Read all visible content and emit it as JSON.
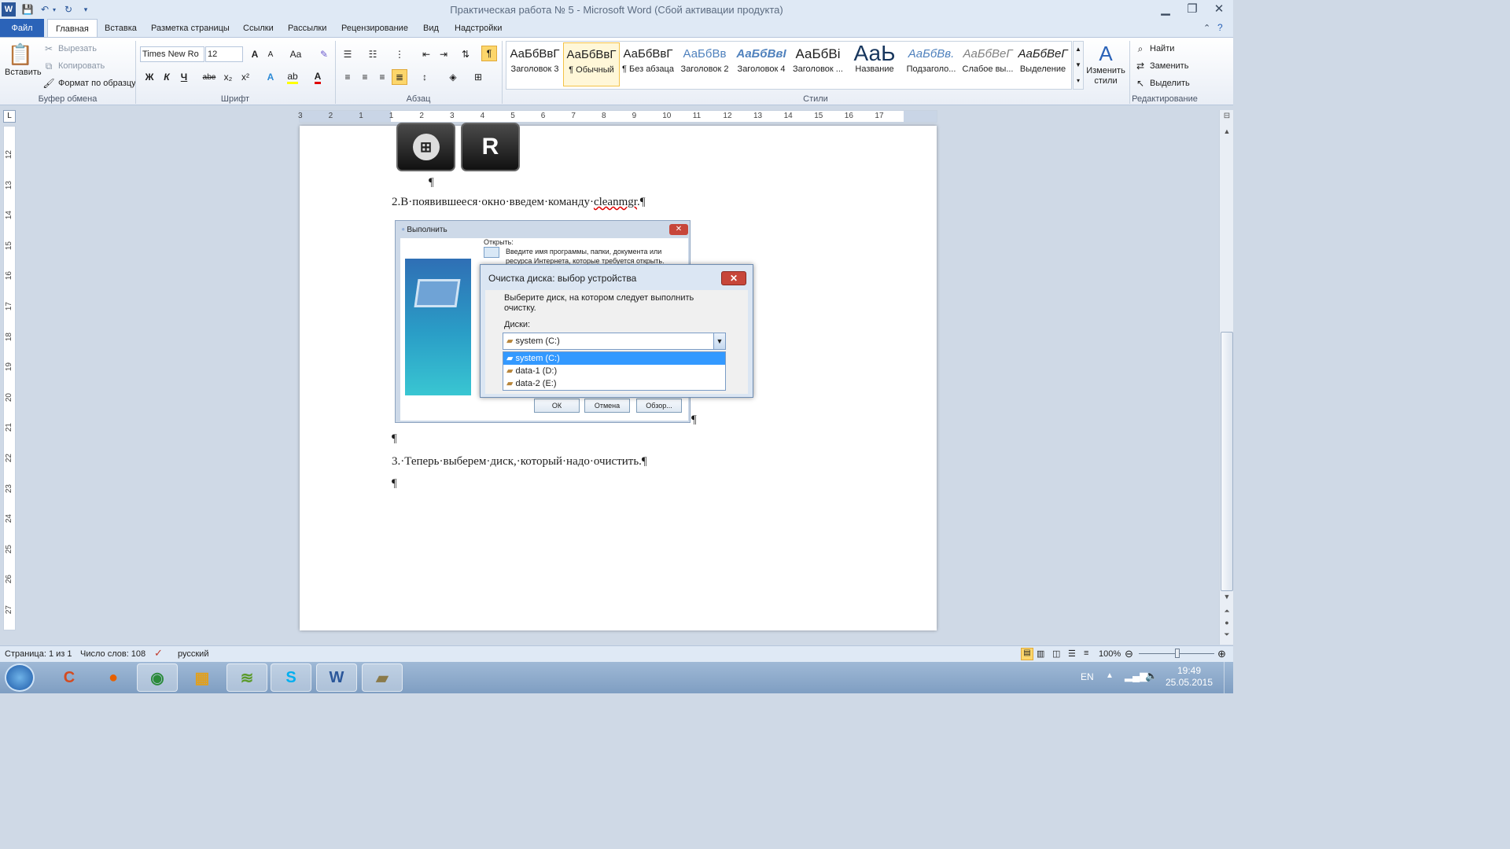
{
  "window": {
    "title": "Практическая работа № 5  -  Microsoft Word (Сбой активации продукта)"
  },
  "tabs": [
    {
      "label": "Файл"
    },
    {
      "label": "Главная"
    },
    {
      "label": "Вставка"
    },
    {
      "label": "Разметка страницы"
    },
    {
      "label": "Ссылки"
    },
    {
      "label": "Рассылки"
    },
    {
      "label": "Рецензирование"
    },
    {
      "label": "Вид"
    },
    {
      "label": "Надстройки"
    }
  ],
  "clipboard": {
    "paste_label": "Вставить",
    "cut_label": "Вырезать",
    "copy_label": "Копировать",
    "format_painter_label": "Формат по образцу",
    "group_label": "Буфер обмена"
  },
  "font": {
    "font_name": "Times New Ro",
    "font_size": "12",
    "group_label": "Шрифт",
    "bold": "Ж",
    "italic": "К",
    "underline": "Ч",
    "strike": "abe",
    "subscript": "x₂",
    "superscript": "x²",
    "grow": "A",
    "case": "Aa",
    "color_a": "A"
  },
  "paragraph": {
    "group_label": "Абзац",
    "pilcrow": "¶"
  },
  "styles": {
    "group_label": "Стили",
    "items": [
      {
        "sample": "АаБбВвГ",
        "name": "Заголовок 3"
      },
      {
        "sample": "АаБбВвГ",
        "name": "¶ Обычный"
      },
      {
        "sample": "АаБбВвГ",
        "name": "¶ Без абзаца"
      },
      {
        "sample": "АаБбВв",
        "name": "Заголовок 2"
      },
      {
        "sample": "АаБбВвІ",
        "name": "Заголовок 4"
      },
      {
        "sample": "АаБбВі",
        "name": "Заголовок ..."
      },
      {
        "sample": "АаЬ",
        "name": "Название"
      },
      {
        "sample": "АаБбВв.",
        "name": "Подзаголо..."
      },
      {
        "sample": "АаБбВеГ",
        "name": "Слабое вы..."
      },
      {
        "sample": "АаБбВеГ",
        "name": "Выделение"
      }
    ],
    "change_styles_label": "Изменить стили"
  },
  "editing": {
    "group_label": "Редактирование",
    "find_label": "Найти",
    "replace_label": "Заменить",
    "select_label": "Выделить"
  },
  "ruler": {
    "h_ticks": [
      "3",
      "2",
      "1",
      "1",
      "2",
      "3",
      "4",
      "5",
      "6",
      "7",
      "8",
      "9",
      "10",
      "11",
      "12",
      "13",
      "14",
      "15",
      "16",
      "17"
    ],
    "v_ticks": [
      "12",
      "13",
      "14",
      "15",
      "16",
      "17",
      "18",
      "19",
      "20",
      "21",
      "22",
      "23",
      "24",
      "25",
      "26",
      "27"
    ]
  },
  "document": {
    "key_r": "R",
    "pilcrow": "¶",
    "line2_prefix": "2.В·появившееся·окно·введем·команду·",
    "line2_word": "cleanmgr",
    "line2_suffix": ".¶",
    "line3": "3.·Теперь·выберем·диск,·который·надо·очистить.¶"
  },
  "run_dialog": {
    "title": "Выполнить",
    "open_label": "Открыть:",
    "hint_line1": "Введите имя программы, папки, документа или",
    "hint_line2": "ресурса Интернета, которые требуется открыть.",
    "ok": "ОК",
    "cancel": "Отмена",
    "browse": "Обзор..."
  },
  "cleanup_dialog": {
    "title": "Очистка диска: выбор устройства",
    "prompt_line1": "Выберите диск, на котором следует выполнить",
    "prompt_line2": "очистку.",
    "drives_label": "Диски:",
    "selected": "system (C:)",
    "options": [
      "system (C:)",
      "data-1 (D:)",
      "data-2 (E:)"
    ]
  },
  "status": {
    "page": "Страница: 1 из 1",
    "words": "Число слов: 108",
    "language": "русский",
    "zoom": "100%"
  },
  "tray": {
    "lang": "EN",
    "time": "19:49",
    "date": "25.05.2015"
  },
  "colors": {
    "accent": "#2b63b8",
    "selection": "#3399ff"
  }
}
